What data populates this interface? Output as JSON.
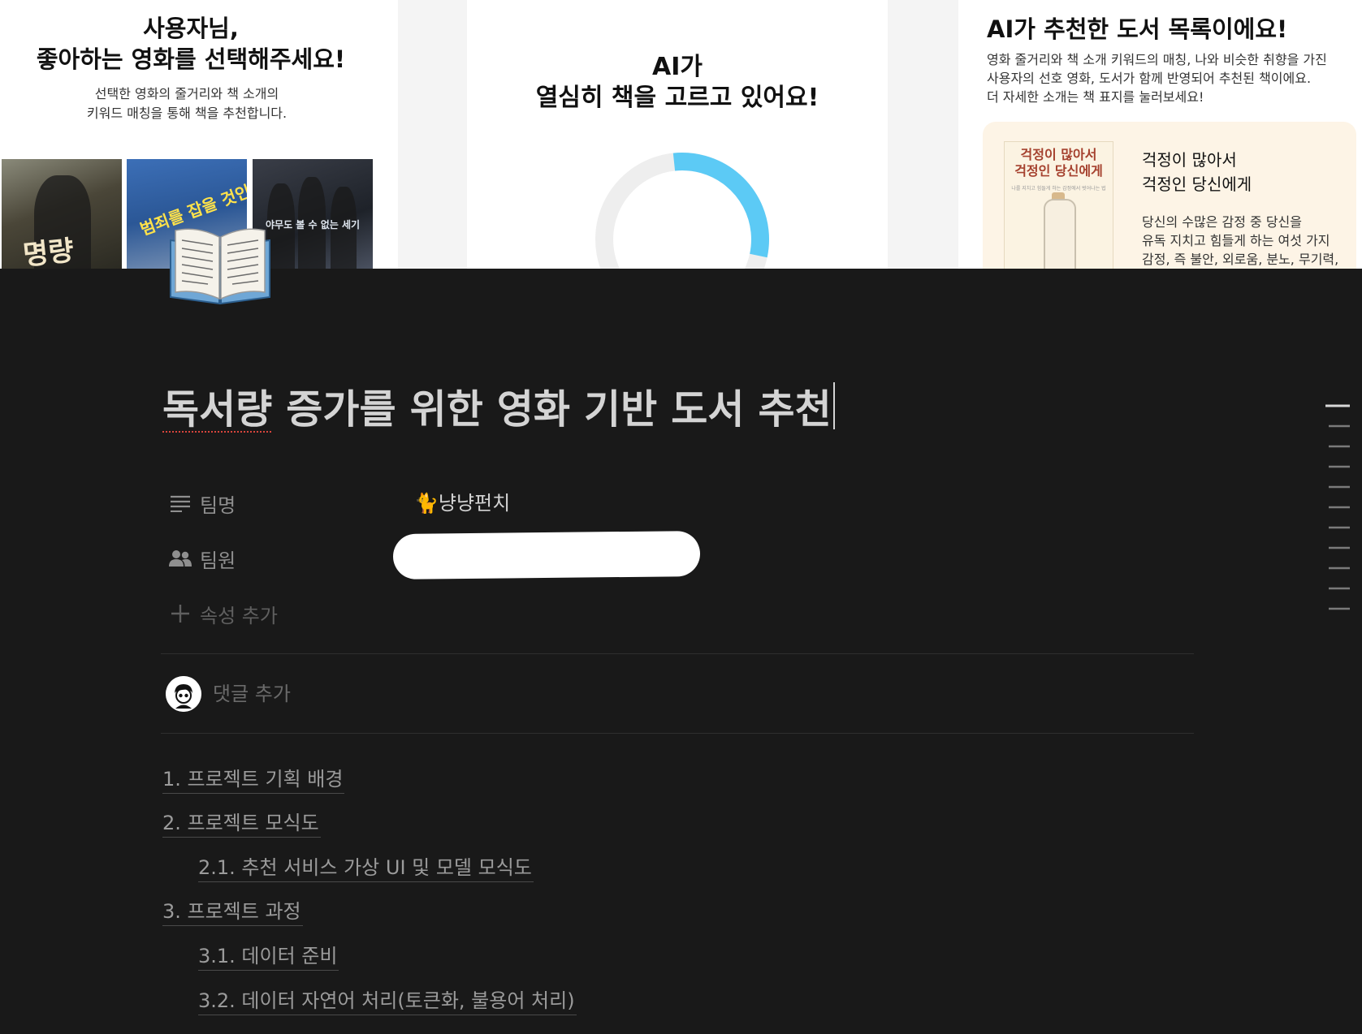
{
  "cover": {
    "card1": {
      "title_line1": "사용자님,",
      "title_line2": "좋아하는 영화를 선택해주세요!",
      "sub_line1": "선택한 영화의 줄거리와 책 소개의",
      "sub_line2": "키워드 매칭을 통해 책을 추천합니다.",
      "posters": [
        {
          "text": "명량"
        },
        {
          "text": "범죄를 잡을 것인가"
        },
        {
          "text": "야무도 볼 수 없는 세기"
        }
      ]
    },
    "card2": {
      "title_line1": "AI가",
      "title_line2": "열심히 책을 고르고 있어요!",
      "progress": 0.3,
      "colors": {
        "track": "#eeeeee",
        "fill": "#5ccaf5"
      }
    },
    "card3": {
      "title": "AI가 추천한 도서 목록이에요!",
      "sub_line1": "영화 줄거리와 책 소개 키워드의 매칭, 나와 비슷한 취향을 가진",
      "sub_line2": "사용자의 선호 영화, 도서가 함께 반영되어 추천된 책이에요.",
      "sub_line3": "더 자세한 소개는 책 표지를 눌러보세요!",
      "book": {
        "cover_line1": "걱정이 많아서",
        "cover_line2": "걱정인 당신에게",
        "cover_small": "나를 지치고 힘들게 하는 감정에서 벗어나는 법",
        "title_line1": "걱정이 많아서",
        "title_line2": "걱정인 당신에게",
        "desc_line1": "당신의 수많은 감정 중 당신을",
        "desc_line2": "유독 지치고 힘들게 하는 여섯 가지",
        "desc_line3": "감정, 즉 불안, 외로움, 분노, 무기력,"
      }
    }
  },
  "page": {
    "icon": "open-book-icon",
    "title_part1": "독서량",
    "title_part2": " 증가를 위한 영화 기반 도서 추천",
    "properties": {
      "team_label": "팀명",
      "team_value": "🐈냥냥펀치",
      "members_label": "팀원",
      "add_property": "속성 추가"
    },
    "comment_placeholder": "댓글 추가",
    "toc": [
      {
        "label": "1. 프로젝트 기획 배경",
        "level": 1
      },
      {
        "label": "2. 프로젝트 모식도",
        "level": 1
      },
      {
        "label": "2.1. 추천 서비스 가상 UI 및 모델 모식도",
        "level": 2
      },
      {
        "label": "3. 프로젝트 과정",
        "level": 1
      },
      {
        "label": "3.1. 데이터 준비",
        "level": 2
      },
      {
        "label": "3.2. 데이터 자연어 처리(토큰화, 불용어 처리)",
        "level": 2
      }
    ]
  }
}
